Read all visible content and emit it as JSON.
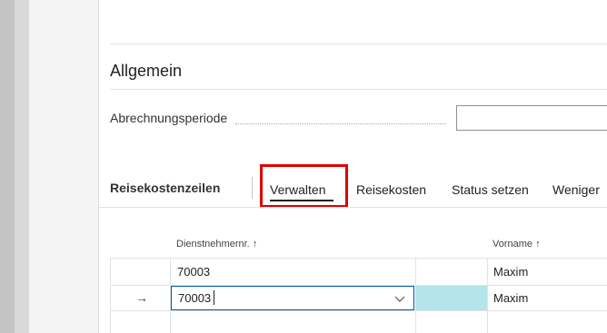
{
  "section": {
    "title": "Allgemein",
    "field_label": "Abrechnungsperiode"
  },
  "lines": {
    "title": "Reisekostenzeilen",
    "actions": [
      "Verwalten",
      "Reisekosten",
      "Status setzen",
      "Weniger"
    ]
  },
  "table": {
    "columns": [
      "Dienstnehmernr. ↑",
      "Vorname ↑"
    ],
    "rows": [
      {
        "arrow": "",
        "employee_no": "70003",
        "first_name": "Maxim"
      },
      {
        "arrow": "→",
        "employee_no": "70003",
        "first_name": "Maxim"
      }
    ]
  },
  "colors": {
    "highlight": "#e00000",
    "active_cell": "#b3e5ea",
    "focus_border": "#005a9e"
  },
  "icons": [
    "arrow-right-icon",
    "chevron-down-icon"
  ]
}
